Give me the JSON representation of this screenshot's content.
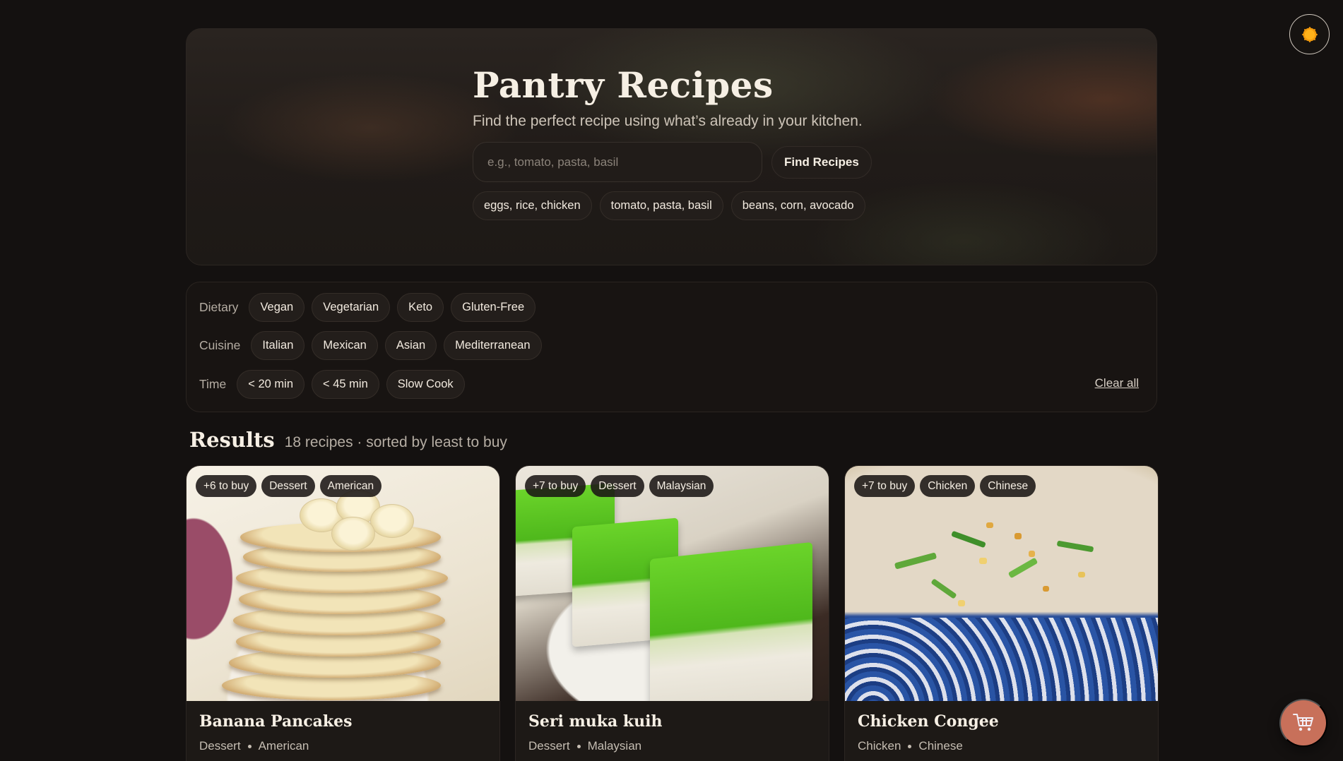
{
  "hero": {
    "title": "Pantry Recipes",
    "subtitle": "Find the perfect recipe using what’s already in your kitchen.",
    "search_placeholder": "e.g., tomato, pasta, basil",
    "find_button": "Find Recipes",
    "suggestions": [
      "eggs, rice, chicken",
      "tomato, pasta, basil",
      "beans, corn, avocado"
    ]
  },
  "filters": {
    "dietary": {
      "label": "Dietary",
      "options": [
        "Vegan",
        "Vegetarian",
        "Keto",
        "Gluten-Free"
      ]
    },
    "cuisine": {
      "label": "Cuisine",
      "options": [
        "Italian",
        "Mexican",
        "Asian",
        "Mediterranean"
      ]
    },
    "time": {
      "label": "Time",
      "options": [
        "< 20 min",
        "< 45 min",
        "Slow Cook"
      ]
    },
    "clear_all": "Clear all"
  },
  "results": {
    "heading": "Results",
    "meta": "18 recipes · sorted by least to buy",
    "cards": [
      {
        "title": "Banana Pancakes",
        "badges": [
          "+6 to buy",
          "Dessert",
          "American"
        ],
        "category": "Dessert",
        "cuisine": "American"
      },
      {
        "title": "Seri muka kuih",
        "badges": [
          "+7 to buy",
          "Dessert",
          "Malaysian"
        ],
        "category": "Dessert",
        "cuisine": "Malaysian"
      },
      {
        "title": "Chicken Congee",
        "badges": [
          "+7 to buy",
          "Chicken",
          "Chinese"
        ],
        "category": "Chicken",
        "cuisine": "Chinese"
      }
    ]
  },
  "icons": {
    "theme_toggle": "sun-icon",
    "cart": "cart-icon"
  },
  "colors": {
    "background": "#141110",
    "accent": "#c8705a",
    "theme_icon": "#f29a0c"
  }
}
